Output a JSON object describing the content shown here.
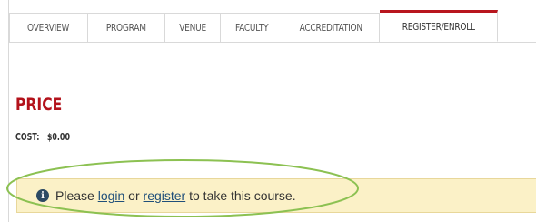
{
  "tabs": [
    {
      "label": "OVERVIEW"
    },
    {
      "label": "PROGRAM"
    },
    {
      "label": "VENUE"
    },
    {
      "label": "FACULTY"
    },
    {
      "label": "ACCREDITATION"
    },
    {
      "label": "REGISTER/ENROLL",
      "active": true
    }
  ],
  "price": {
    "heading": "PRICE",
    "cost_label": "COST:",
    "cost_value": "$0.00"
  },
  "notice": {
    "icon": "info-icon",
    "text_before": "Please ",
    "login_link": "login",
    "text_middle": " or ",
    "register_link": "register",
    "text_after": " to take this course."
  },
  "colors": {
    "accent": "#b3121b",
    "notice_bg": "#fbf1c7",
    "highlight_ellipse": "#8cc152"
  }
}
